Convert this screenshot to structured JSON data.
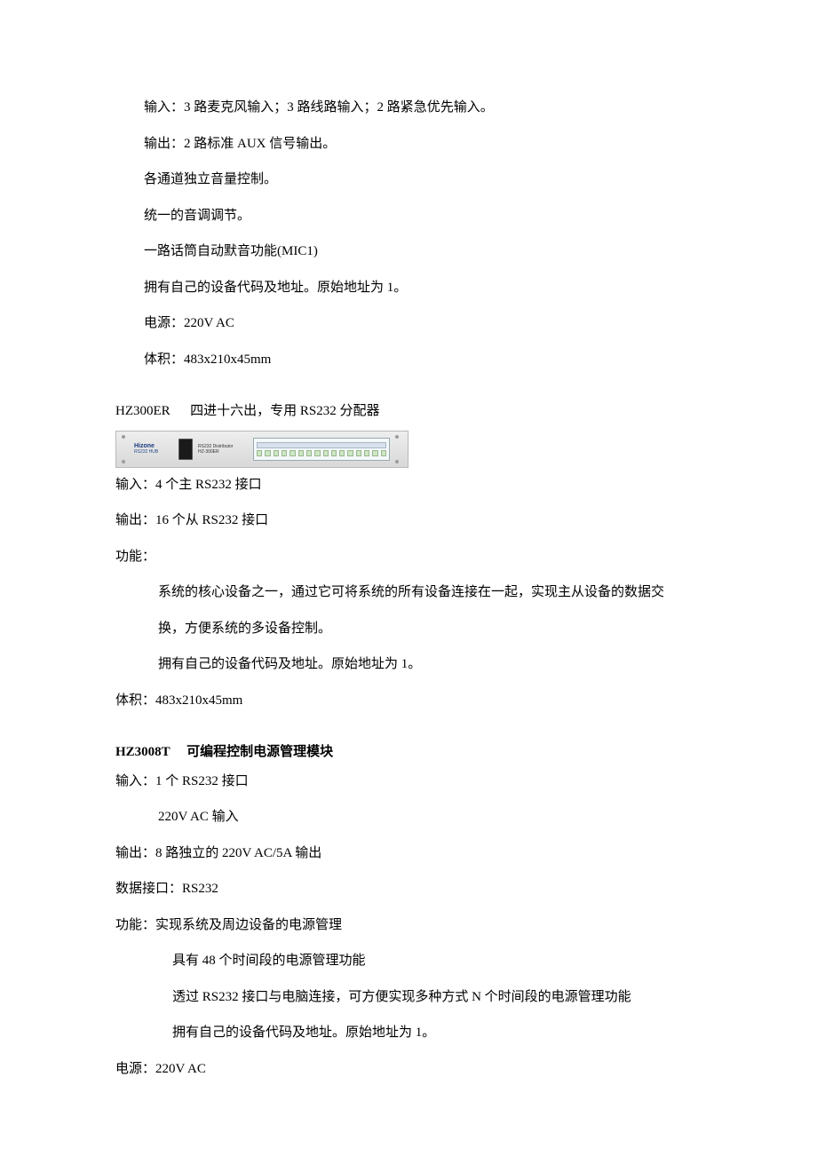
{
  "section1": {
    "lines": [
      "输入：3 路麦克风输入；3 路线路输入；2 路紧急优先输入。",
      "输出：2 路标准 AUX 信号输出。",
      "各通道独立音量控制。",
      "统一的音调调节。",
      "一路话筒自动默音功能(MIC1)",
      "拥有自己的设备代码及地址。原始地址为 1。",
      "电源：220V AC",
      "体积：483x210x45mm"
    ]
  },
  "section2": {
    "heading_model": "HZ300ER",
    "heading_desc": "四进十六出，专用 RS232 分配器",
    "device": {
      "brand": "Hizone",
      "sub": "RS232 HUB",
      "model_line1": "RS232 Distributor",
      "model_line2": "HZ-300ER"
    },
    "input": "输入：4 个主 RS232 接口",
    "output": "输出：16 个从 RS232 接口",
    "func_label": "功能：",
    "func_lines": [
      "系统的核心设备之一，通过它可将系统的所有设备连接在一起，实现主从设备的数据交",
      "换，方便系统的多设备控制。",
      "拥有自己的设备代码及地址。原始地址为 1。"
    ],
    "volume": "体积：483x210x45mm"
  },
  "section3": {
    "heading_model": "HZ3008T",
    "heading_desc": "可编程控制电源管理模块",
    "input_l1": "输入：1 个 RS232 接口",
    "input_l2": "220V AC 输入",
    "output": "输出：8 路独立的 220V AC/5A 输出",
    "dataport": "数据接口：RS232",
    "func_l1": "功能：实现系统及周边设备的电源管理",
    "func_lines": [
      "具有 48 个时间段的电源管理功能",
      "透过 RS232 接口与电脑连接，可方便实现多种方式 N 个时间段的电源管理功能",
      "拥有自己的设备代码及地址。原始地址为 1。"
    ],
    "power": "电源：220V AC"
  }
}
